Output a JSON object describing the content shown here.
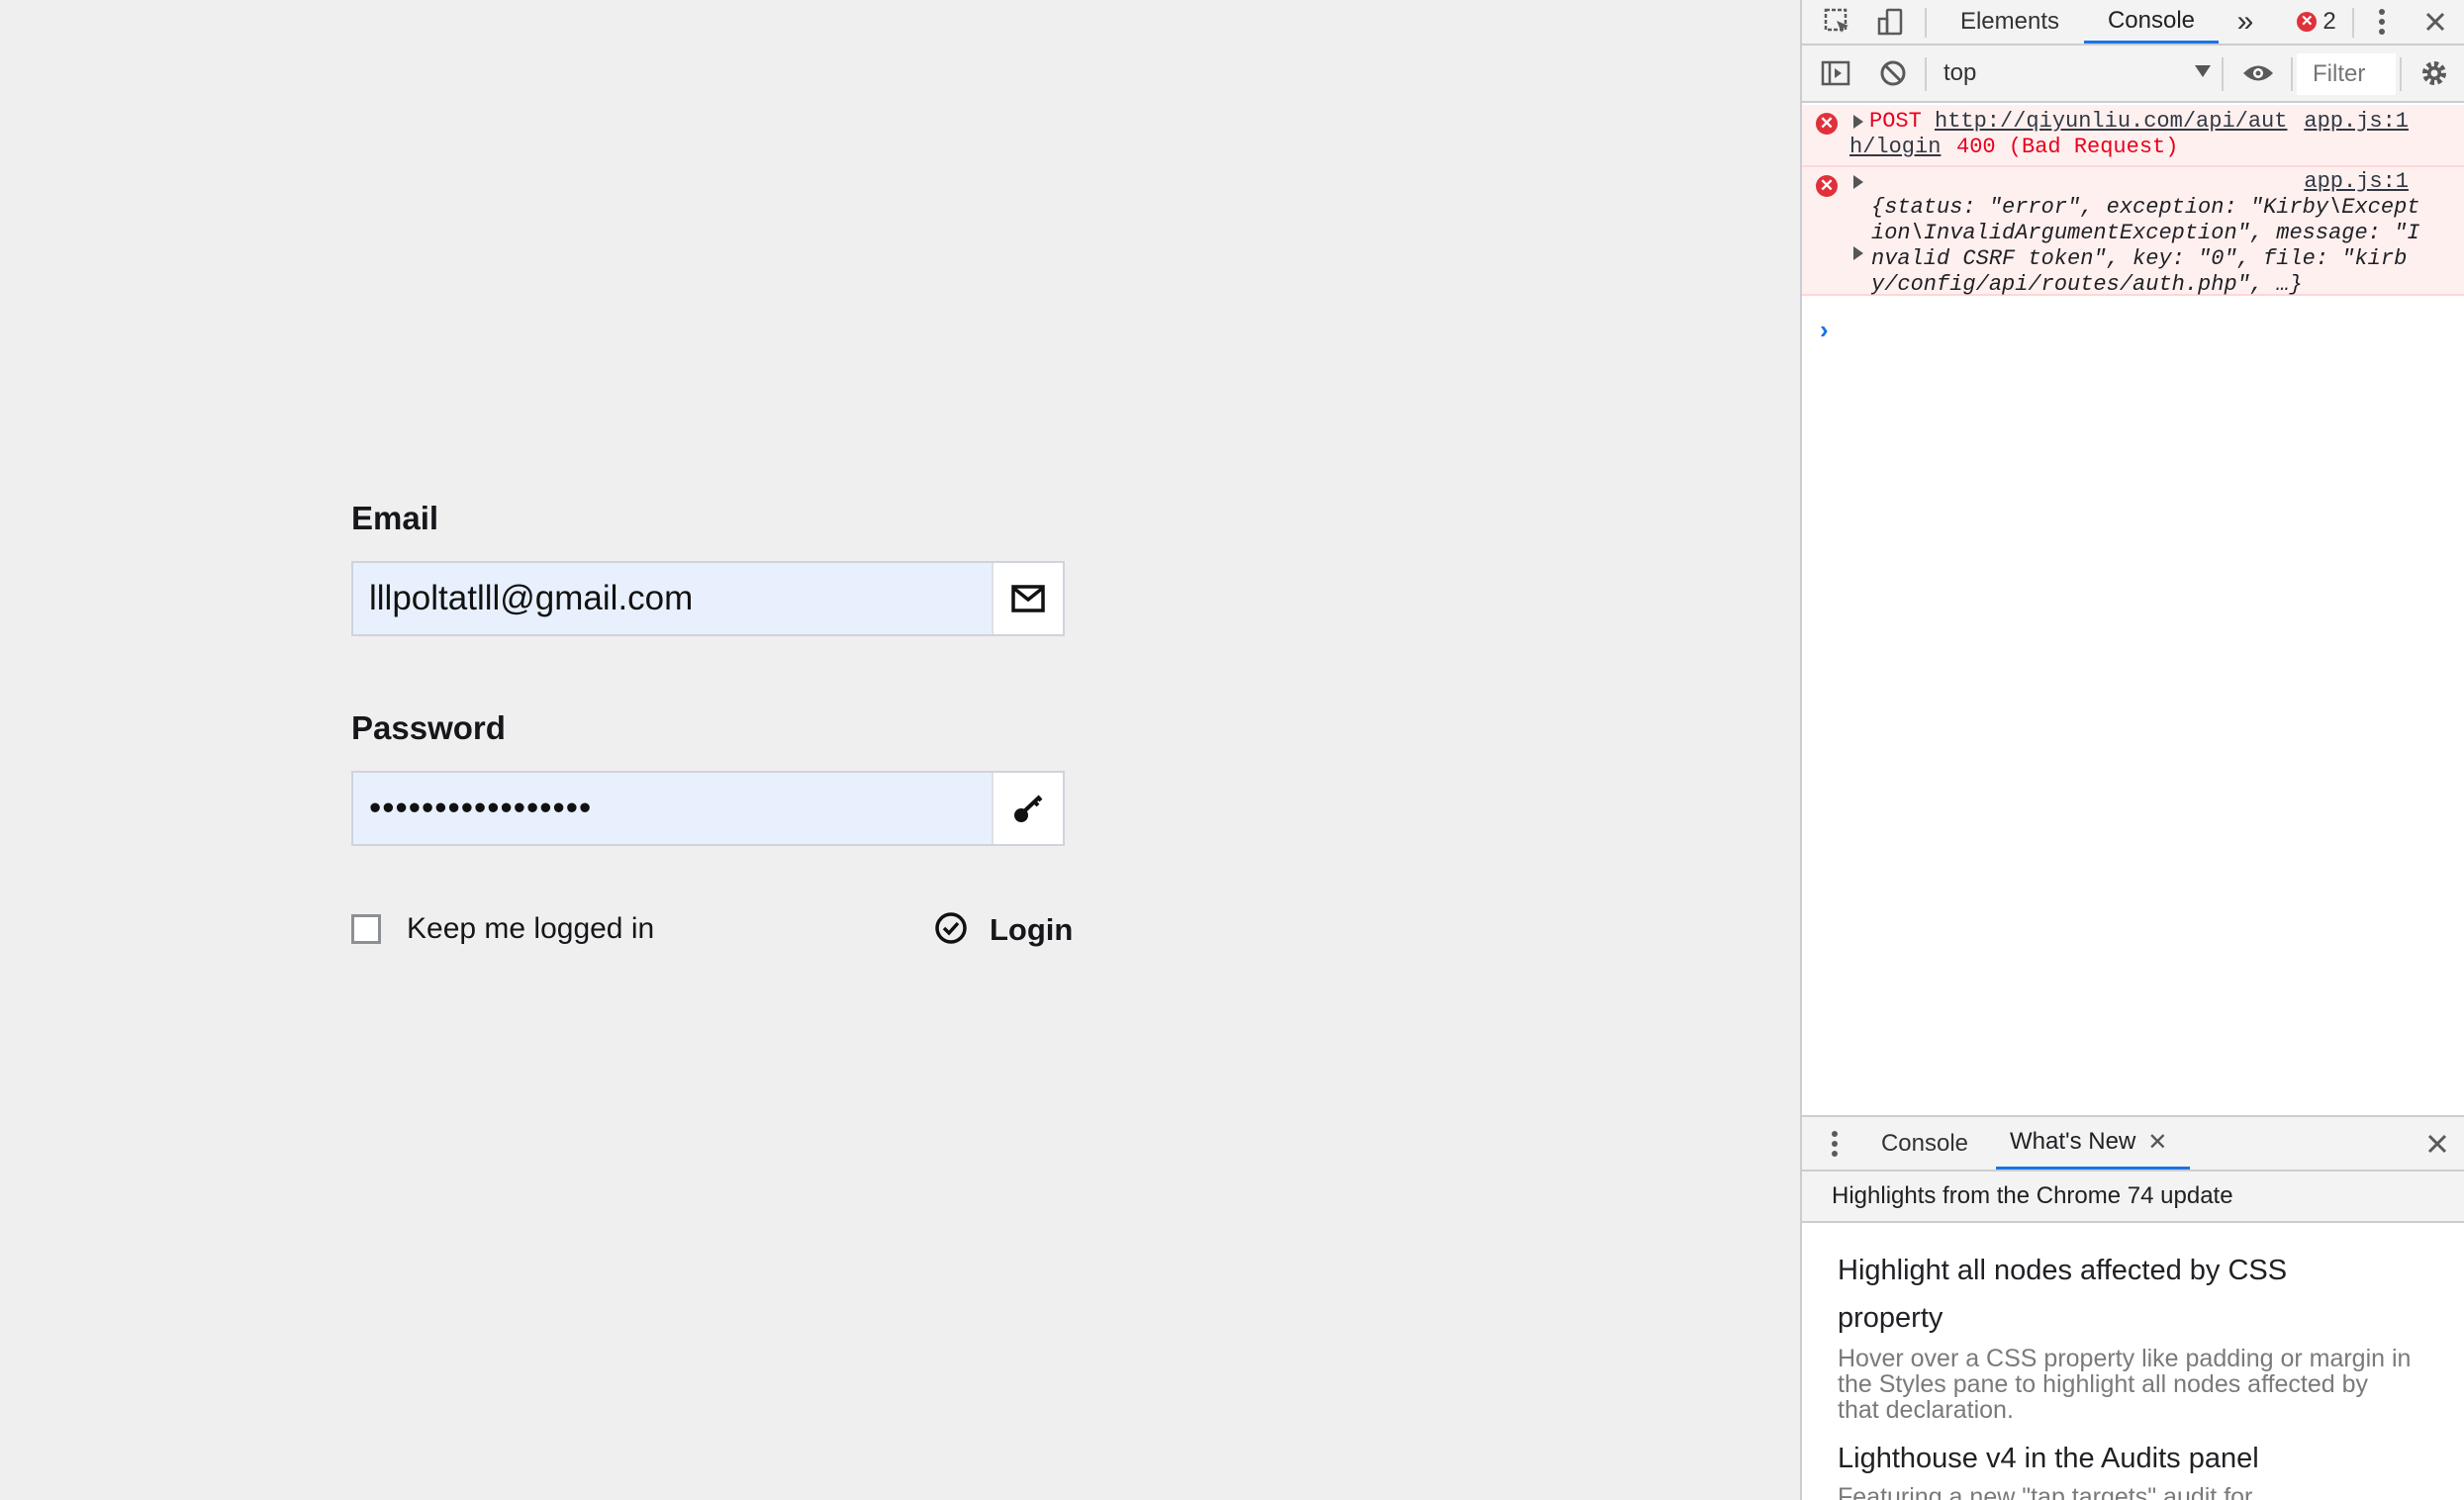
{
  "login": {
    "email_label": "Email",
    "email_value": "lllpoltatlll@gmail.com",
    "email_icon": "envelope-icon",
    "password_label": "Password",
    "password_value": "•••••••••••••••••",
    "password_icon": "key-icon",
    "remember_label": "Keep me logged in",
    "login_label": "Login",
    "login_icon": "check-circle-icon",
    "input_bg": "#e8f0fe"
  },
  "devtools": {
    "tabs": [
      "Elements",
      "Console"
    ],
    "active_tab": "Console",
    "more_tabs_glyph": "»",
    "error_count": "2",
    "context": "top",
    "filter_placeholder": "Filter",
    "messages": [
      {
        "method": "POST",
        "url_part1": "http://qiyunliu.com/api/aut",
        "url_part2": "h/login",
        "status": "400 (Bad Request)",
        "source": "app.js:1"
      },
      {
        "source": "app.js:1",
        "lines": [
          "{status: \"error\", exception: \"Kirby\\Except",
          "ion\\InvalidArgumentException\", message: \"I",
          "nvalid CSRF token\", key: \"0\", file: \"kirb",
          "y/config/api/routes/auth.php\", …}"
        ]
      }
    ],
    "prompt": "›",
    "drawer": {
      "tabs": [
        "Console",
        "What's New"
      ],
      "active_tab": "What's New",
      "subtitle": "Highlights from the Chrome 74 update",
      "items": [
        {
          "title_line1": "Highlight all nodes affected by CSS",
          "title_line2": "property",
          "description": "Hover over a CSS property like padding or margin in the Styles pane to highlight all nodes affected by that declaration."
        },
        {
          "title_line1": "Lighthouse v4 in the Audits panel",
          "description": "Featuring a new \"tap targets\" audit for"
        }
      ]
    },
    "accent_color": "#1a73e8",
    "error_color": "#e8001c"
  }
}
